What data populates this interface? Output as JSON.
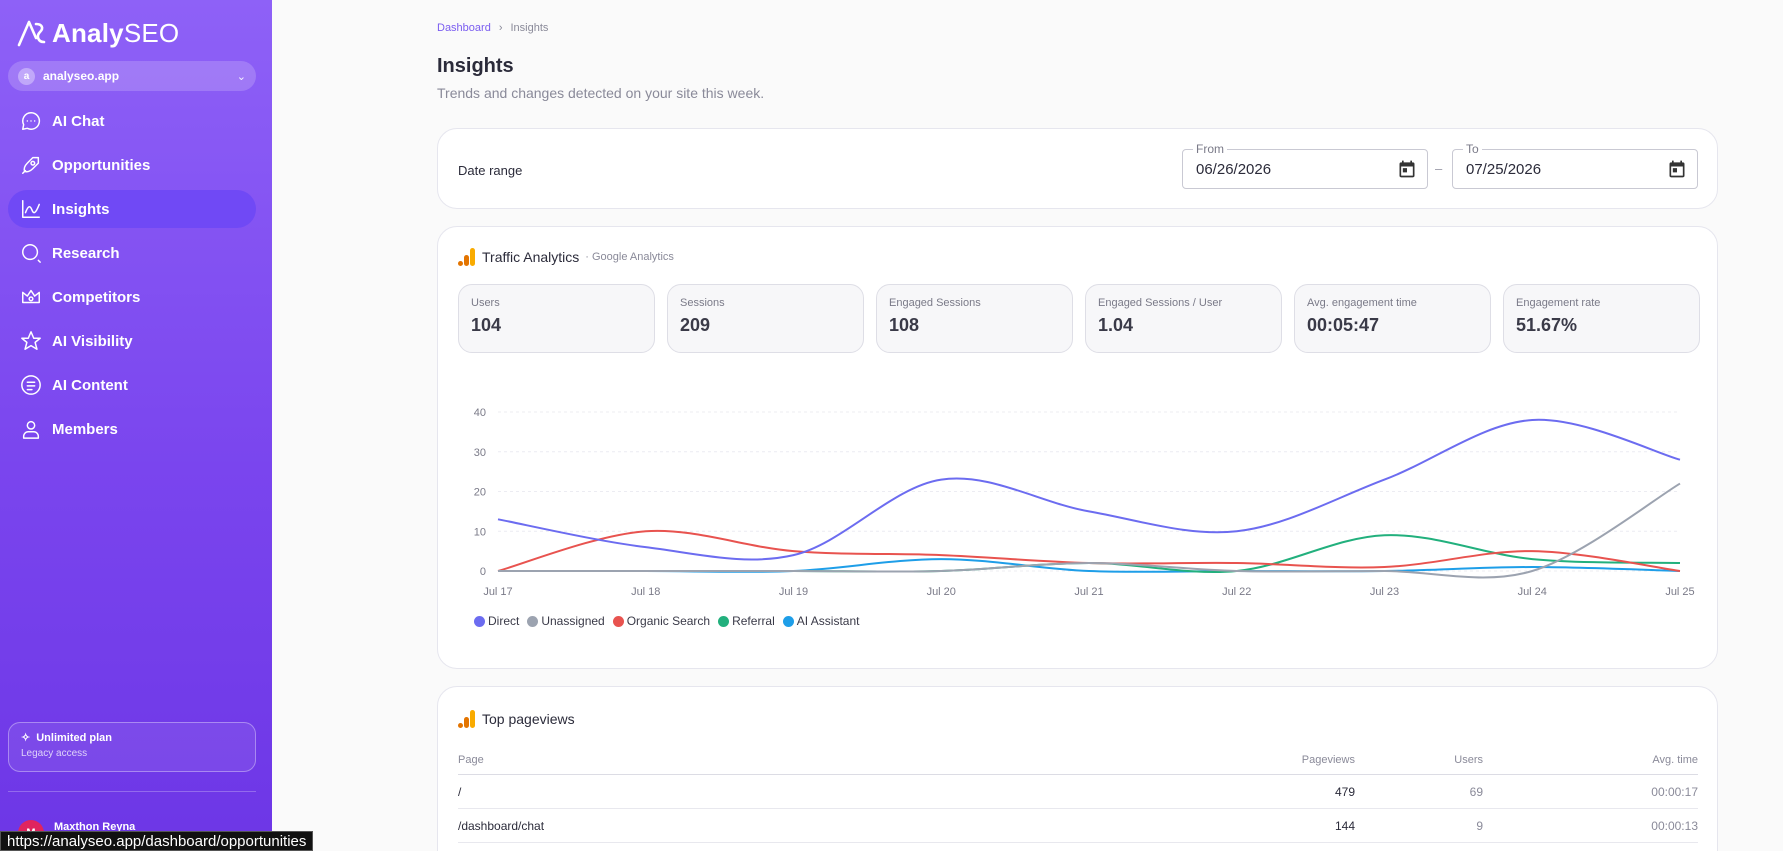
{
  "app": {
    "logo_text_bold": "Analy",
    "logo_text_light": "SEO"
  },
  "site_selector": {
    "icon_letter": "a",
    "value": "analyseo.app"
  },
  "sidebar": {
    "items": [
      {
        "label": "AI Chat",
        "icon": "chat-icon",
        "active": false
      },
      {
        "label": "Opportunities",
        "icon": "rocket-icon",
        "active": false
      },
      {
        "label": "Insights",
        "icon": "line-chart-icon",
        "active": true
      },
      {
        "label": "Research",
        "icon": "search-icon",
        "active": false
      },
      {
        "label": "Competitors",
        "icon": "crown-icon",
        "active": false
      },
      {
        "label": "AI Visibility",
        "icon": "star-icon",
        "active": false
      },
      {
        "label": "AI Content",
        "icon": "document-icon",
        "active": false
      },
      {
        "label": "Members",
        "icon": "user-icon",
        "active": false
      }
    ],
    "plan": {
      "title": "Unlimited plan",
      "subtitle": "Legacy access"
    },
    "user": {
      "name": "Maxthon Reyna",
      "initial": "M"
    }
  },
  "status_bar_url": "https://analyseo.app/dashboard/opportunities",
  "breadcrumb": {
    "root": "Dashboard",
    "separator": "›",
    "current": "Insights"
  },
  "page": {
    "title": "Insights",
    "subtitle": "Trends and changes detected on your site this week."
  },
  "date_range": {
    "label": "Date range",
    "from_label": "From",
    "from_value": "06/26/2026",
    "separator": "–",
    "to_label": "To",
    "to_value": "07/25/2026"
  },
  "traffic": {
    "title": "Traffic Analytics",
    "source": "· Google Analytics",
    "metrics": [
      {
        "label": "Users",
        "value": "104"
      },
      {
        "label": "Sessions",
        "value": "209"
      },
      {
        "label": "Engaged Sessions",
        "value": "108"
      },
      {
        "label": "Engaged Sessions / User",
        "value": "1.04"
      },
      {
        "label": "Avg. engagement time",
        "value": "00:05:47"
      },
      {
        "label": "Engagement rate",
        "value": "51.67%"
      }
    ]
  },
  "chart_data": {
    "type": "line",
    "x": [
      "Jul 17",
      "Jul 18",
      "Jul 19",
      "Jul 20",
      "Jul 21",
      "Jul 22",
      "Jul 23",
      "Jul 24",
      "Jul 25"
    ],
    "ylim": [
      0,
      40
    ],
    "yticks": [
      0,
      10,
      20,
      30,
      40
    ],
    "grid": true,
    "legend": "bottom-left",
    "series": [
      {
        "name": "Direct",
        "color": "#6c6cf0",
        "values": [
          13,
          6,
          4,
          23,
          15,
          10,
          23,
          38,
          28
        ]
      },
      {
        "name": "Unassigned",
        "color": "#9ca3b0",
        "values": [
          0,
          0,
          0,
          0,
          2,
          0,
          0,
          0,
          22
        ]
      },
      {
        "name": "Organic Search",
        "color": "#e8534f",
        "values": [
          0,
          10,
          5,
          4,
          2,
          2,
          1,
          5,
          0
        ]
      },
      {
        "name": "Referral",
        "color": "#22b07d",
        "values": [
          0,
          0,
          0,
          0,
          2,
          0,
          9,
          3,
          2
        ]
      },
      {
        "name": "AI Assistant",
        "color": "#1e9ee8",
        "values": [
          0,
          0,
          0,
          3,
          0,
          0,
          0,
          1,
          0
        ]
      }
    ]
  },
  "pageviews": {
    "title": "Top pageviews",
    "columns": {
      "page": "Page",
      "pageviews": "Pageviews",
      "users": "Users",
      "avg_time": "Avg. time"
    },
    "rows": [
      {
        "page": "/",
        "pageviews": "479",
        "users": "69",
        "avg_time": "00:00:17"
      },
      {
        "page": "/dashboard/chat",
        "pageviews": "144",
        "users": "9",
        "avg_time": "00:00:13"
      }
    ]
  }
}
